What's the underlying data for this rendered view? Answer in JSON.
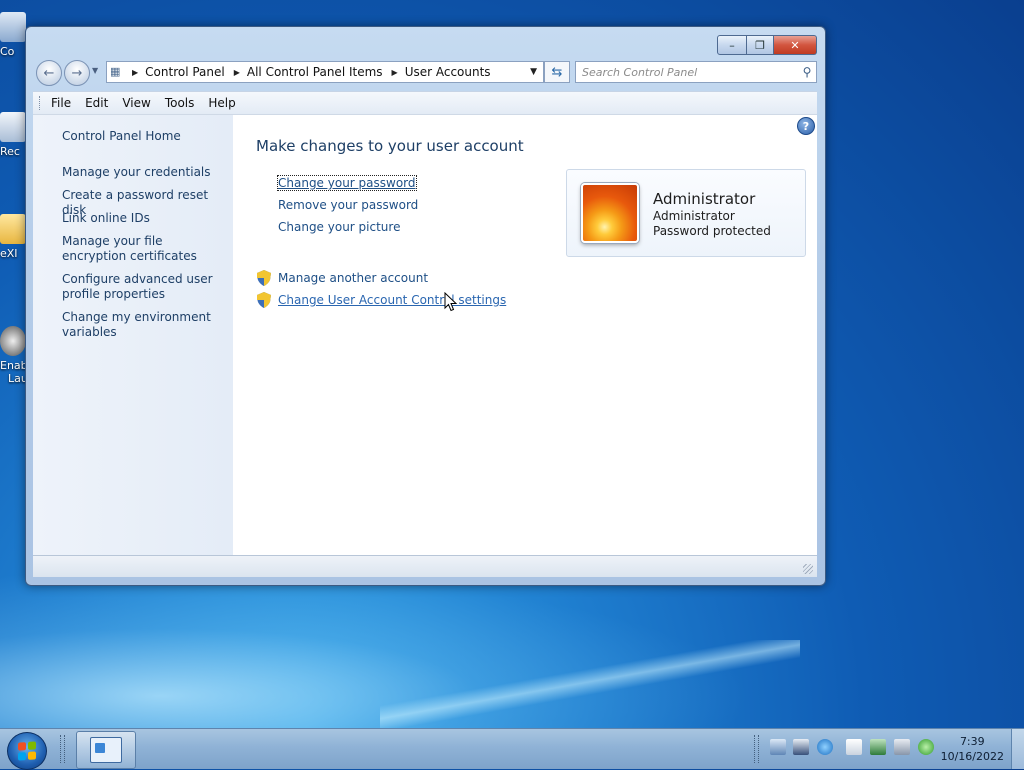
{
  "desktop": {
    "icons": [
      {
        "label": "Co"
      },
      {
        "label": "Rec"
      },
      {
        "label": "eXI"
      },
      {
        "label": "Enab",
        "label2": "Lau"
      }
    ]
  },
  "window": {
    "address": {
      "crumbs": [
        "Control Panel",
        "All Control Panel Items",
        "User Accounts"
      ]
    },
    "search": {
      "placeholder": "Search Control Panel"
    },
    "menu": [
      "File",
      "Edit",
      "View",
      "Tools",
      "Help"
    ],
    "sidebar": {
      "home": "Control Panel Home",
      "links": [
        "Manage your credentials",
        "Create a password reset disk",
        "Link online IDs",
        "Manage your file encryption certificates",
        "Configure advanced user profile properties",
        "Change my environment variables"
      ]
    },
    "main": {
      "title": "Make changes to your user account",
      "tasks": [
        "Change your password",
        "Remove your password",
        "Change your picture"
      ],
      "shield_tasks": [
        "Manage another account",
        "Change User Account Control settings"
      ]
    },
    "account": {
      "name": "Administrator",
      "type": "Administrator",
      "status": "Password protected"
    }
  },
  "taskbar": {
    "time": "7:39",
    "date": "10/16/2022"
  },
  "colors": {
    "link": "#1e4f86",
    "title": "#1e3f66",
    "close_button": "#c03a22"
  }
}
